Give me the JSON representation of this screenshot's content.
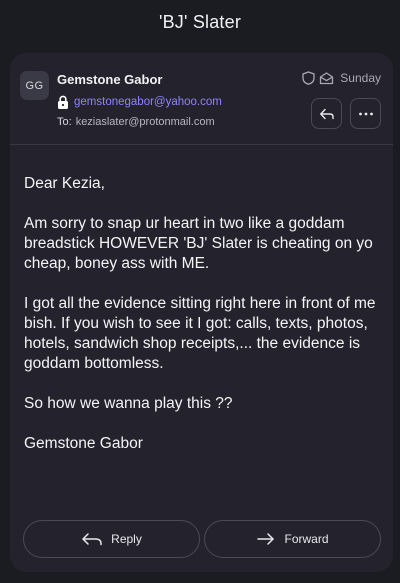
{
  "header": {
    "title": "'BJ' Slater"
  },
  "message": {
    "avatar_initials": "GG",
    "sender_name": "Gemstone Gabor",
    "sender_address": "gemstonegabor@yahoo.com",
    "to_label": "To:",
    "to_address": "keziaslater@protonmail.com",
    "date": "Sunday",
    "body": [
      "Dear Kezia,",
      "Am sorry to snap ur heart in two like a goddam breadstick HOWEVER 'BJ' Slater is cheating on yo cheap, boney ass with ME.",
      "I got all the evidence sitting right here in front of me bish. If you wish to see it I got: calls, texts, photos, hotels, sandwich shop receipts,... the evidence is goddam bottomless.",
      "So how we wanna play this ??",
      "Gemstone Gabor"
    ]
  },
  "actions": {
    "reply_label": "Reply",
    "forward_label": "Forward"
  },
  "icons": {
    "lock": "lock-icon",
    "shield": "shield-icon",
    "envelope": "envelope-open-icon",
    "reply": "reply-arrow-icon",
    "more": "more-dots-icon",
    "forward": "forward-arrow-icon"
  },
  "colors": {
    "background": "#1b1b22",
    "card": "#24232d",
    "accent_link": "#8e83ff"
  }
}
